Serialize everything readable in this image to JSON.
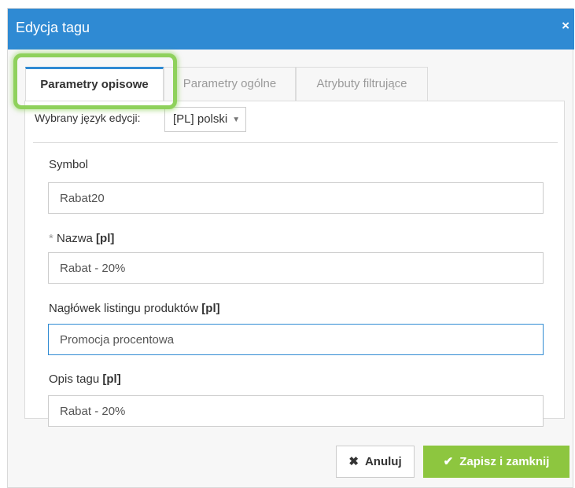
{
  "dialog": {
    "title": "Edycja tagu",
    "close_icon": "×"
  },
  "tabs": [
    {
      "label": "Parametry opisowe",
      "active": true
    },
    {
      "label": "Parametry ogólne",
      "active": false
    },
    {
      "label": "Atrybuty filtrujące",
      "active": false
    }
  ],
  "language": {
    "label": "Wybrany język edycji:",
    "selected": "[PL] polski",
    "caret": "▼"
  },
  "fields": {
    "symbol": {
      "label": "Symbol",
      "value": "Rabat20"
    },
    "nazwa": {
      "required_mark": "*",
      "label": "Nazwa",
      "lang_tag": "[pl]",
      "value": "Rabat - 20%"
    },
    "naglowek": {
      "label": "Nagłówek listingu produktów",
      "lang_tag": "[pl]",
      "value": "Promocja procentowa",
      "focused": true
    },
    "opis": {
      "label": "Opis tagu",
      "lang_tag": "[pl]",
      "value": "Rabat - 20%"
    }
  },
  "buttons": {
    "cancel": {
      "icon": "✖",
      "label": "Anuluj"
    },
    "save": {
      "icon": "✔",
      "label": "Zapisz i zamknij"
    }
  },
  "colors": {
    "header": "#2f8ad3",
    "save_button": "#8dc63f",
    "tab_highlight": "#8fd15c"
  }
}
